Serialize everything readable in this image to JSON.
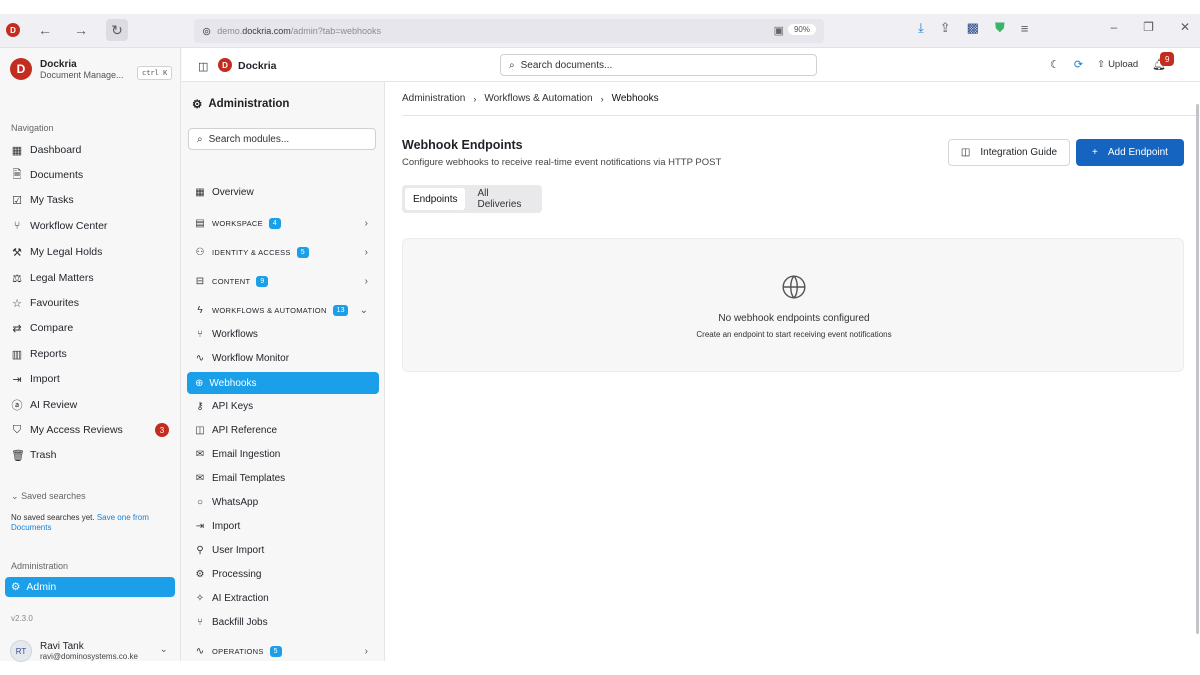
{
  "browser": {
    "url_prefix": "demo.",
    "url_domain": "dockria.com",
    "url_path": "/admin?tab=webhooks",
    "zoom": "90%"
  },
  "sidebar": {
    "brand_name": "Dockria",
    "brand_sub": "Document Manage...",
    "shortcut": "ctrl K",
    "nav_label": "Navigation",
    "items": [
      {
        "label": "Dashboard",
        "icon": "grid-icon"
      },
      {
        "label": "Documents",
        "icon": "file-icon"
      },
      {
        "label": "My Tasks",
        "icon": "tasks-icon"
      },
      {
        "label": "Workflow Center",
        "icon": "workflow-icon"
      },
      {
        "label": "My Legal Holds",
        "icon": "gavel-icon"
      },
      {
        "label": "Legal Matters",
        "icon": "scales-icon"
      },
      {
        "label": "Favourites",
        "icon": "star-icon"
      },
      {
        "label": "Compare",
        "icon": "compare-icon"
      },
      {
        "label": "Reports",
        "icon": "chart-icon"
      },
      {
        "label": "Import",
        "icon": "import-icon"
      },
      {
        "label": "AI Review",
        "icon": "ai-icon"
      },
      {
        "label": "My Access Reviews",
        "icon": "shield-icon",
        "badge": "3"
      },
      {
        "label": "Trash",
        "icon": "trash-icon"
      }
    ],
    "saved_label": "Saved searches",
    "saved_text": "No saved searches yet.",
    "saved_link_1": "Save one from",
    "saved_link_2": "Documents",
    "admin_label": "Administration",
    "admin_item": "Admin",
    "version": "v2.3.0",
    "user": {
      "initials": "RT",
      "name": "Ravi Tank",
      "email": "ravi@dominosystems.co.ke"
    }
  },
  "topnav": {
    "brand": "Dockria",
    "search_placeholder": "Search documents...",
    "upload_label": "Upload",
    "notif_count": "9"
  },
  "modules": {
    "title": "Administration",
    "search_placeholder": "Search modules...",
    "overview": "Overview",
    "groups": {
      "workspace": {
        "label": "WORKSPACE",
        "count": "4"
      },
      "identity": {
        "label": "IDENTITY & ACCESS",
        "count": "5"
      },
      "content": {
        "label": "CONTENT",
        "count": "9"
      },
      "workflows": {
        "label": "WORKFLOWS & AUTOMATION",
        "count": "13"
      },
      "operations": {
        "label": "OPERATIONS",
        "count": "5"
      }
    },
    "items": [
      "Workflows",
      "Workflow Monitor",
      "Webhooks",
      "API Keys",
      "API Reference",
      "Email Ingestion",
      "Email Templates",
      "WhatsApp",
      "Import",
      "User Import",
      "Processing",
      "AI Extraction",
      "Backfill Jobs"
    ]
  },
  "main": {
    "breadcrumb": [
      "Administration",
      "Workflows & Automation",
      "Webhooks"
    ],
    "title": "Webhook Endpoints",
    "subtitle": "Configure webhooks to receive real-time event notifications via HTTP POST",
    "guide_button": "Integration Guide",
    "add_button": "Add Endpoint",
    "tabs": [
      "Endpoints",
      "All Deliveries"
    ],
    "empty_title": "No webhook endpoints configured",
    "empty_sub": "Create an endpoint to start receiving event notifications"
  }
}
